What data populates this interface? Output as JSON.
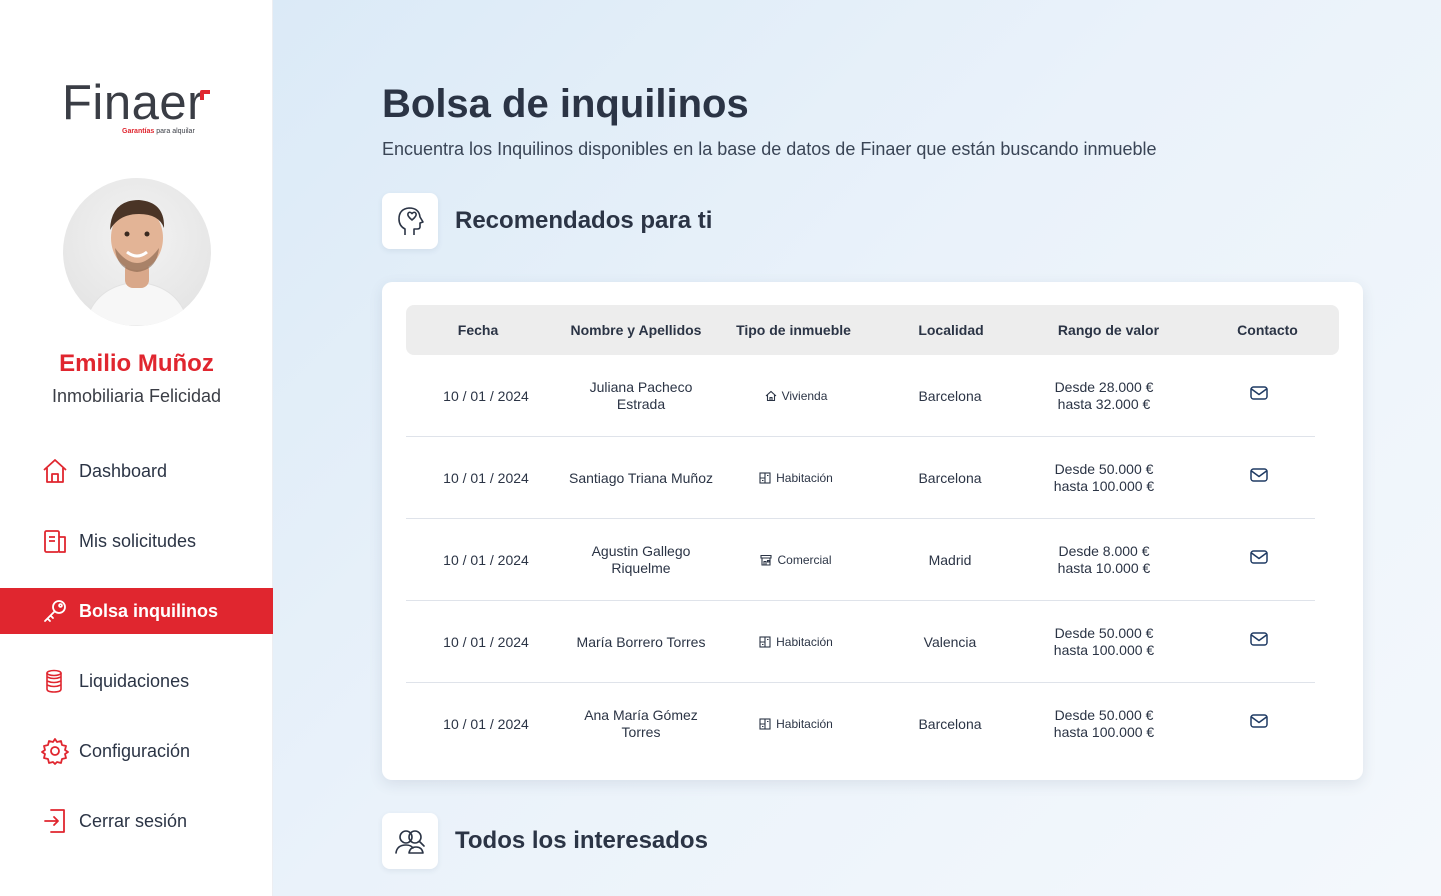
{
  "brand": {
    "name": "Finaer",
    "tagline_highlight": "Garantías",
    "tagline_rest": "para alquilar"
  },
  "user": {
    "name": "Emilio Muñoz",
    "company": "Inmobiliaria Felicidad"
  },
  "nav": {
    "items": [
      {
        "label": "Dashboard",
        "icon": "home-icon"
      },
      {
        "label": "Mis solicitudes",
        "icon": "document-icon"
      },
      {
        "label": "Bolsa inquilinos",
        "icon": "key-icon",
        "active": true
      },
      {
        "label": "Liquidaciones",
        "icon": "coins-icon"
      },
      {
        "label": "Configuración",
        "icon": "gear-icon"
      },
      {
        "label": "Cerrar sesión",
        "icon": "logout-icon"
      }
    ]
  },
  "page": {
    "title": "Bolsa de inquilinos",
    "subtitle": "Encuentra los Inquilinos disponibles en la base de datos de Finaer que están buscando  inmueble"
  },
  "recommended": {
    "title": "Recomendados para ti",
    "columns": [
      "Fecha",
      "Nombre y Apellidos",
      "Tipo de inmueble",
      "Localidad",
      "Rango de valor",
      "Contacto"
    ],
    "rows": [
      {
        "date": "10 / 01 / 2024",
        "name": "Juliana Pacheco Estrada",
        "type": "Vivienda",
        "type_icon": "house-icon",
        "city": "Barcelona",
        "range_from": "Desde 28.000 €",
        "range_to": "hasta 32.000 €"
      },
      {
        "date": "10 / 01 / 2024",
        "name": "Santiago Triana Muñoz",
        "type": "Habitación",
        "type_icon": "room-icon",
        "city": "Barcelona",
        "range_from": "Desde 50.000 €",
        "range_to": "hasta 100.000 €"
      },
      {
        "date": "10 / 01 / 2024",
        "name": "Agustin Gallego Riquelme",
        "type": "Comercial",
        "type_icon": "store-icon",
        "city": "Madrid",
        "range_from": "Desde 8.000 €",
        "range_to": "hasta 10.000 €"
      },
      {
        "date": "10 / 01 / 2024",
        "name": "María Borrero Torres",
        "type": "Habitación",
        "type_icon": "room-icon",
        "city": "Valencia",
        "range_from": "Desde 50.000 €",
        "range_to": "hasta 100.000 €"
      },
      {
        "date": "10 / 01 / 2024",
        "name": "Ana María Gómez Torres",
        "type": "Habitación",
        "type_icon": "room-icon",
        "city": "Barcelona",
        "range_from": "Desde 50.000 €",
        "range_to": "hasta 100.000 €"
      }
    ]
  },
  "all": {
    "title": "Todos los interesados"
  },
  "colors": {
    "accent": "#e0262f",
    "text": "#2b3445",
    "table_header_bg": "#ededed"
  }
}
